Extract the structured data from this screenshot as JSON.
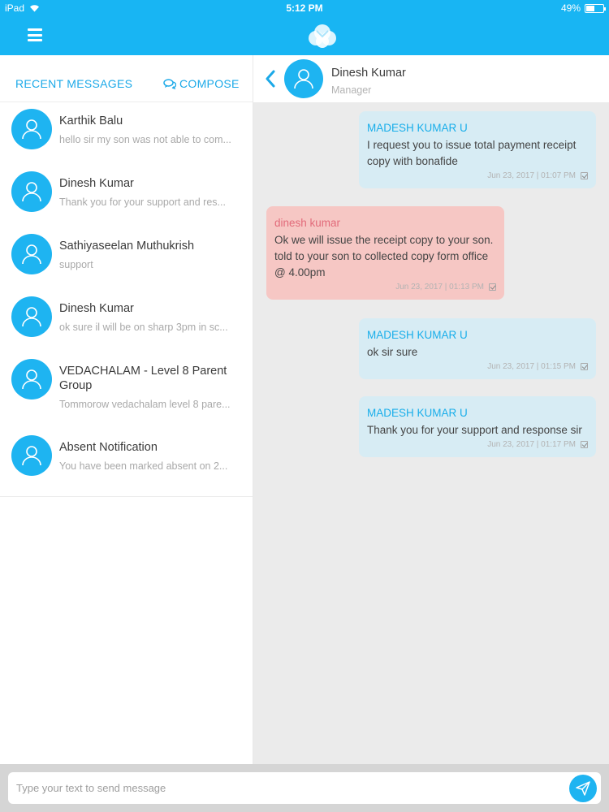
{
  "status_bar": {
    "device": "iPad",
    "time": "5:12 PM",
    "battery": "49%",
    "battery_level": 0.49
  },
  "colors": {
    "accent": "#18b5f3",
    "outgoing_bubble": "#d7ecf4",
    "incoming_bubble": "#f6c7c4",
    "incoming_sender": "#e26b7a"
  },
  "app_bar": {
    "menu_icon": "hamburger-icon",
    "logo_icon": "cloud-heart-logo"
  },
  "sidebar": {
    "recent_label": "RECENT MESSAGES",
    "compose_label": "COMPOSE",
    "compose_icon": "chat-bubbles-icon",
    "conversations": [
      {
        "name": "Karthik Balu",
        "snippet": "hello sir my son was not able to com..."
      },
      {
        "name": "Dinesh Kumar",
        "snippet": "Thank you for your support and res..."
      },
      {
        "name": "Sathiyaseelan Muthukrish",
        "snippet": "support"
      },
      {
        "name": "Dinesh Kumar",
        "snippet": "ok sure il will be on sharp 3pm in sc..."
      },
      {
        "name": "VEDACHALAM - Level 8 Parent Group",
        "snippet": "Tommorow vedachalam level 8 pare..."
      },
      {
        "name": "Absent Notification",
        "snippet": "You have been marked absent on 2..."
      }
    ]
  },
  "chat": {
    "contact_name": "Dinesh Kumar",
    "contact_role": "Manager",
    "messages": [
      {
        "direction": "out",
        "sender": "MADESH KUMAR U",
        "text": "I request you to issue total payment receipt copy with bonafide",
        "time": "Jun 23, 2017 | 01:07 PM"
      },
      {
        "direction": "in",
        "sender": "dinesh kumar",
        "text": "Ok we will issue the receipt copy to your son. told to your son to collected copy form office @ 4.00pm",
        "time": "Jun 23, 2017 | 01:13 PM"
      },
      {
        "direction": "out",
        "sender": "MADESH KUMAR U",
        "text": "ok sir sure",
        "time": "Jun 23, 2017 | 01:15 PM"
      },
      {
        "direction": "out",
        "sender": "MADESH KUMAR U",
        "text": "Thank you for your support and response sir",
        "time": "Jun 23, 2017 | 01:17 PM"
      }
    ]
  },
  "composer": {
    "placeholder": "Type your text to send message"
  }
}
